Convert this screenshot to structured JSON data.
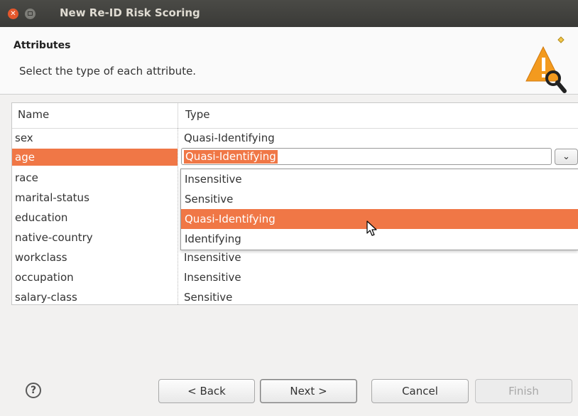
{
  "window": {
    "title": "New Re-ID Risk Scoring"
  },
  "header": {
    "title": "Attributes",
    "description": "Select the type of each attribute."
  },
  "table": {
    "columns": [
      "Name",
      "Type"
    ],
    "rows": [
      {
        "name": "sex",
        "type": "Quasi-Identifying"
      },
      {
        "name": "age",
        "type": "Quasi-Identifying"
      },
      {
        "name": "race",
        "type": ""
      },
      {
        "name": "marital-status",
        "type": ""
      },
      {
        "name": "education",
        "type": ""
      },
      {
        "name": "native-country",
        "type": ""
      },
      {
        "name": "workclass",
        "type": "Insensitive"
      },
      {
        "name": "occupation",
        "type": "Insensitive"
      },
      {
        "name": "salary-class",
        "type": "Sensitive"
      }
    ],
    "selected_row": "age"
  },
  "combo": {
    "value": "Quasi-Identifying"
  },
  "dropdown": {
    "options": [
      "Insensitive",
      "Sensitive",
      "Quasi-Identifying",
      "Identifying"
    ],
    "highlighted": "Quasi-Identifying"
  },
  "buttons": {
    "back": "< Back",
    "next": "Next >",
    "cancel": "Cancel",
    "finish": "Finish",
    "help": "?"
  },
  "colors": {
    "selection": "#f07746",
    "titlebar": "#3e3e3b",
    "close": "#e4572c"
  }
}
